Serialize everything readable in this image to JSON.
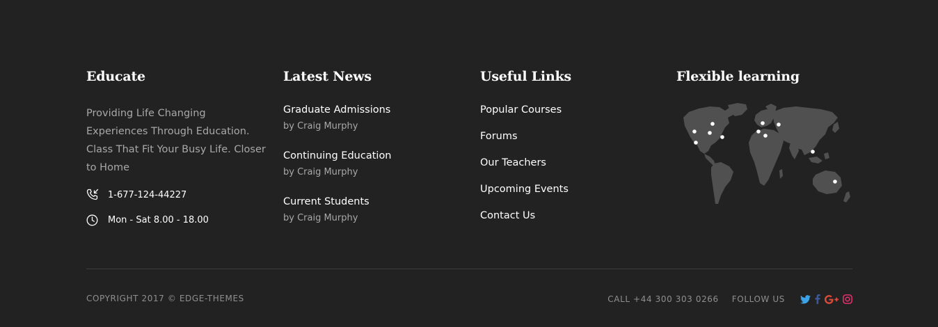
{
  "columns": {
    "about": {
      "title": "Educate",
      "text": "Providing Life Changing Experiences Through Education. Class That Fit Your Busy Life. Closer to Home",
      "phone": "1-677-124-44227",
      "hours": "Mon - Sat 8.00 - 18.00"
    },
    "news": {
      "title": "Latest News",
      "items": [
        {
          "title": "Graduate Admissions",
          "author": "by Craig Murphy"
        },
        {
          "title": "Continuing Education",
          "author": "by Craig Murphy"
        },
        {
          "title": "Current Students",
          "author": "by Craig Murphy"
        }
      ]
    },
    "links": {
      "title": "Useful Links",
      "items": [
        "Popular Courses",
        "Forums",
        "Our Teachers",
        "Upcoming Events",
        "Contact Us"
      ]
    },
    "map": {
      "title": "Flexible learning"
    }
  },
  "bottom": {
    "copyright": "COPYRIGHT 2017 © EDGE-THEMES",
    "call": "CALL +44 300 303 0266",
    "follow": "FOLLOW US",
    "social": [
      {
        "icon": "twitter-icon",
        "color": "#3ca3e8"
      },
      {
        "icon": "facebook-icon",
        "color": "#3b5998"
      },
      {
        "icon": "google-plus-icon",
        "color": "#dd4b39"
      },
      {
        "icon": "instagram-icon",
        "color": "#e1306c"
      }
    ]
  },
  "colors": {
    "background": "#222222",
    "heading": "#ffffff",
    "muted": "#a8a8a8",
    "map_land": "#505050",
    "map_marker": "#ffffff"
  }
}
